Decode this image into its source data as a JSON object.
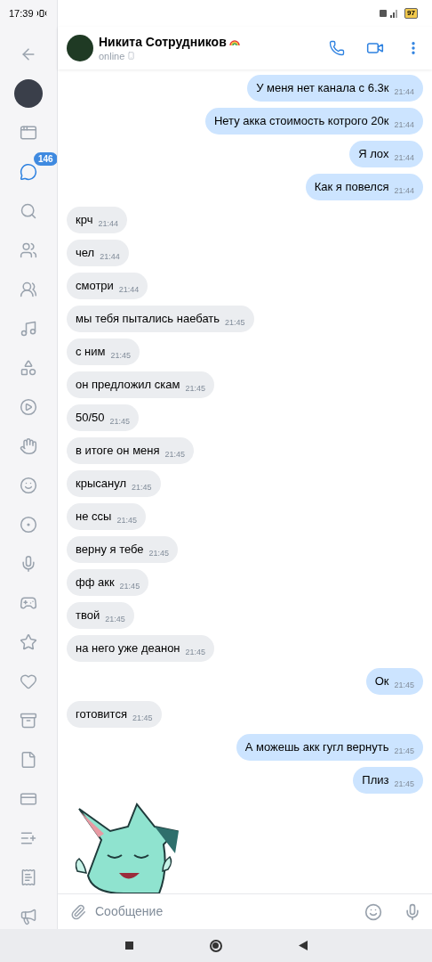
{
  "status_bar": {
    "time": "17:39",
    "battery": "97"
  },
  "sidebar": {
    "items": [
      {
        "kind": "back",
        "selected": false
      },
      {
        "kind": "avatar",
        "selected": false
      },
      {
        "kind": "feed",
        "selected": false
      },
      {
        "kind": "messages",
        "selected": true,
        "badge": "146"
      },
      {
        "kind": "search",
        "selected": false
      },
      {
        "kind": "friends",
        "selected": false
      },
      {
        "kind": "communities",
        "selected": false
      },
      {
        "kind": "music",
        "selected": false
      },
      {
        "kind": "services",
        "selected": false
      },
      {
        "kind": "video",
        "selected": false
      },
      {
        "kind": "clips",
        "selected": false
      },
      {
        "kind": "stickers",
        "selected": false
      },
      {
        "kind": "target",
        "selected": false
      },
      {
        "kind": "podcasts",
        "selected": false
      },
      {
        "kind": "games",
        "selected": false
      },
      {
        "kind": "bookmarks",
        "selected": false
      },
      {
        "kind": "likes",
        "selected": false
      },
      {
        "kind": "archive",
        "selected": false
      },
      {
        "kind": "documents",
        "selected": false
      },
      {
        "kind": "payments",
        "selected": false
      },
      {
        "kind": "wishlist",
        "selected": false
      },
      {
        "kind": "receipts",
        "selected": false
      },
      {
        "kind": "ads",
        "selected": false
      }
    ]
  },
  "header": {
    "name": "Никита Сотрудников",
    "status": "online"
  },
  "messages": [
    {
      "kind": "text",
      "outgoing": true,
      "text": "У меня нет канала с 6.3к",
      "time": "21:44"
    },
    {
      "kind": "text",
      "outgoing": true,
      "text": "Нету акка стоимость котрого 20к",
      "time": "21:44"
    },
    {
      "kind": "text",
      "outgoing": true,
      "text": "Я лох",
      "time": "21:44"
    },
    {
      "kind": "text",
      "outgoing": true,
      "text": "Как я повелся",
      "time": "21:44"
    },
    {
      "kind": "text",
      "outgoing": false,
      "text": "крч",
      "time": "21:44"
    },
    {
      "kind": "text",
      "outgoing": false,
      "text": "чел",
      "time": "21:44"
    },
    {
      "kind": "text",
      "outgoing": false,
      "text": "смотри",
      "time": "21:44"
    },
    {
      "kind": "text",
      "outgoing": false,
      "text": "мы тебя пытались наебать",
      "time": "21:45"
    },
    {
      "kind": "text",
      "outgoing": false,
      "text": "с ним",
      "time": "21:45"
    },
    {
      "kind": "text",
      "outgoing": false,
      "text": "он предложил скам",
      "time": "21:45"
    },
    {
      "kind": "text",
      "outgoing": false,
      "text": "50/50",
      "time": "21:45"
    },
    {
      "kind": "text",
      "outgoing": false,
      "text": "в итоге он меня",
      "time": "21:45"
    },
    {
      "kind": "text",
      "outgoing": false,
      "text": "крысанул",
      "time": "21:45"
    },
    {
      "kind": "text",
      "outgoing": false,
      "text": "не ссы",
      "time": "21:45"
    },
    {
      "kind": "text",
      "outgoing": false,
      "text": "верну я тебе",
      "time": "21:45"
    },
    {
      "kind": "text",
      "outgoing": false,
      "text": "фф акк",
      "time": "21:45"
    },
    {
      "kind": "text",
      "outgoing": false,
      "text": "твой",
      "time": "21:45"
    },
    {
      "kind": "text",
      "outgoing": false,
      "text": "на него уже деанон",
      "time": "21:45"
    },
    {
      "kind": "text",
      "outgoing": true,
      "text": "Ок",
      "time": "21:45"
    },
    {
      "kind": "text",
      "outgoing": false,
      "text": "готовится",
      "time": "21:45"
    },
    {
      "kind": "text",
      "outgoing": true,
      "text": "А можешь акк гугл вернуть",
      "time": "21:45"
    },
    {
      "kind": "text",
      "outgoing": true,
      "text": "Плиз",
      "time": "21:45"
    },
    {
      "kind": "sticker"
    }
  ],
  "composer": {
    "placeholder": "Сообщение"
  }
}
